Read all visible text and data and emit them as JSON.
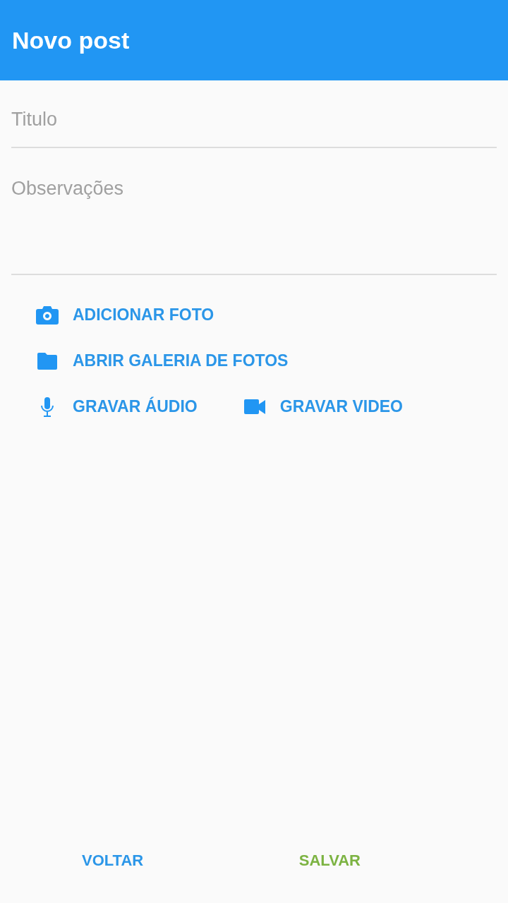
{
  "app_bar": {
    "title": "Novo post"
  },
  "fields": [
    {
      "placeholder": "Titulo",
      "kind": "line"
    },
    {
      "placeholder": "Observações",
      "kind": "area"
    }
  ],
  "action_rows": [
    [
      {
        "label": "ADICIONAR FOTO"
      }
    ],
    [
      {
        "label": "ABRIR GALERIA DE FOTOS"
      }
    ],
    [
      {
        "label": "GRAVAR ÁUDIO"
      },
      {
        "label": "GRAVAR VIDEO"
      }
    ]
  ],
  "footer_buttons": [
    {
      "label": "VOLTAR",
      "kind": "cancel"
    },
    {
      "label": "SALVAR",
      "kind": "confirm"
    }
  ]
}
